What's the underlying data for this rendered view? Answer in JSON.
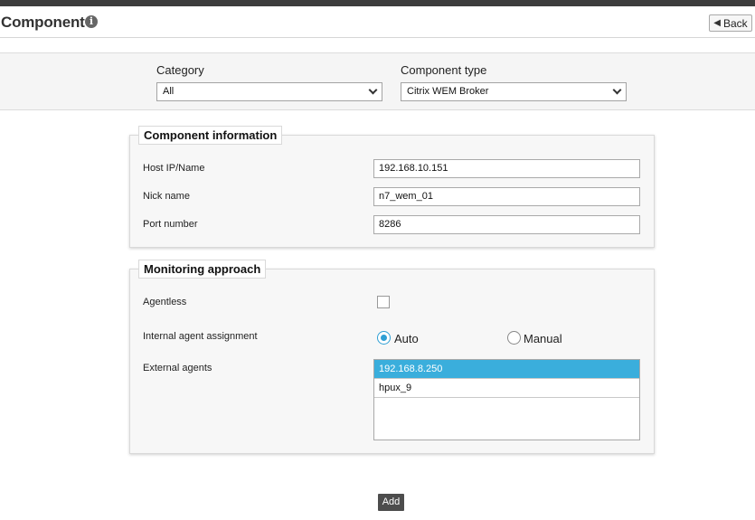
{
  "header": {
    "title": "Component",
    "back_label": "Back"
  },
  "filters": {
    "category_label": "Category",
    "category_value": "All",
    "component_type_label": "Component type",
    "component_type_value": "Citrix WEM Broker"
  },
  "component_info": {
    "legend": "Component information",
    "host_label": "Host IP/Name",
    "host_value": "192.168.10.151",
    "nick_label": "Nick name",
    "nick_value": "n7_wem_01",
    "port_label": "Port number",
    "port_value": "8286"
  },
  "monitoring": {
    "legend": "Monitoring approach",
    "agentless_label": "Agentless",
    "agentless_checked": false,
    "internal_label": "Internal agent assignment",
    "internal_options": [
      "Auto",
      "Manual"
    ],
    "internal_selected": "Auto",
    "external_label": "External agents",
    "external_agents": [
      "192.168.8.250",
      "hpux_9"
    ],
    "external_selected": "192.168.8.250"
  },
  "actions": {
    "add_label": "Add"
  },
  "colors": {
    "accent": "#2e9fd4",
    "selection": "#3aaedc",
    "topbar": "#3d3d3d",
    "button_dark": "#4d4d4d"
  }
}
